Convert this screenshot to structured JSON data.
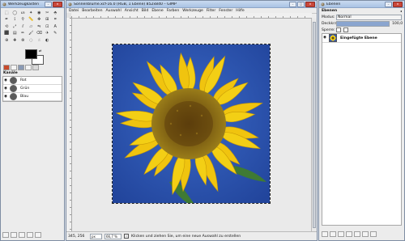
{
  "toolbox": {
    "title": "Werkzeugkasten",
    "tools": [
      "rect-select-icon",
      "ellipse-select-icon",
      "lasso-icon",
      "fuzzy-select-icon",
      "color-select-icon",
      "scissors-icon",
      "foreground-select-icon",
      "paths-icon",
      "color-picker-icon",
      "zoom-icon",
      "measure-icon",
      "move-icon",
      "align-icon",
      "crop-icon",
      "rotate-icon",
      "scale-icon",
      "shear-icon",
      "perspective-icon",
      "flip-icon",
      "cage-icon",
      "text-icon",
      "bucket-fill-icon",
      "blend-icon",
      "pencil-icon",
      "paintbrush-icon",
      "eraser-icon",
      "airbrush-icon",
      "ink-icon",
      "clone-icon",
      "heal-icon",
      "perspective-clone-icon",
      "blur-icon",
      "smudge-icon",
      "dodge-burn-icon"
    ],
    "fg_color": "#000000",
    "bg_color": "#ffffff"
  },
  "channels": {
    "title": "Kanäle",
    "items": [
      {
        "label": "Rot"
      },
      {
        "label": "Grün"
      },
      {
        "label": "Blau"
      }
    ]
  },
  "image_window": {
    "title": "Sonnenblume.xcf-16.0 (RGB, 1 Ebene) 852x840 – GIMP",
    "menu": [
      "Datei",
      "Bearbeiten",
      "Auswahl",
      "Ansicht",
      "Bild",
      "Ebene",
      "Farben",
      "Werkzeuge",
      "Filter",
      "Fenster",
      "Hilfe"
    ],
    "status": {
      "coords": "345, 256",
      "unit": "px",
      "zoom": "66,7 %",
      "message": "Klicken und ziehen Sie, um eine neue Auswahl zu erstellen"
    }
  },
  "layers": {
    "title": "Ebenen",
    "tab": "Ebenen",
    "mode_label": "Modus:",
    "mode_value": "Normal",
    "opacity_label": "Deckkraft:",
    "opacity_value": "100,0",
    "lock_label": "Sperre:",
    "items": [
      {
        "label": "Eingefügte Ebene"
      }
    ]
  },
  "colors": {
    "canvas_bg": "#eaeaea",
    "sky": "#2f56b6",
    "petal": "#f3cf15",
    "center": "#6a5012"
  }
}
